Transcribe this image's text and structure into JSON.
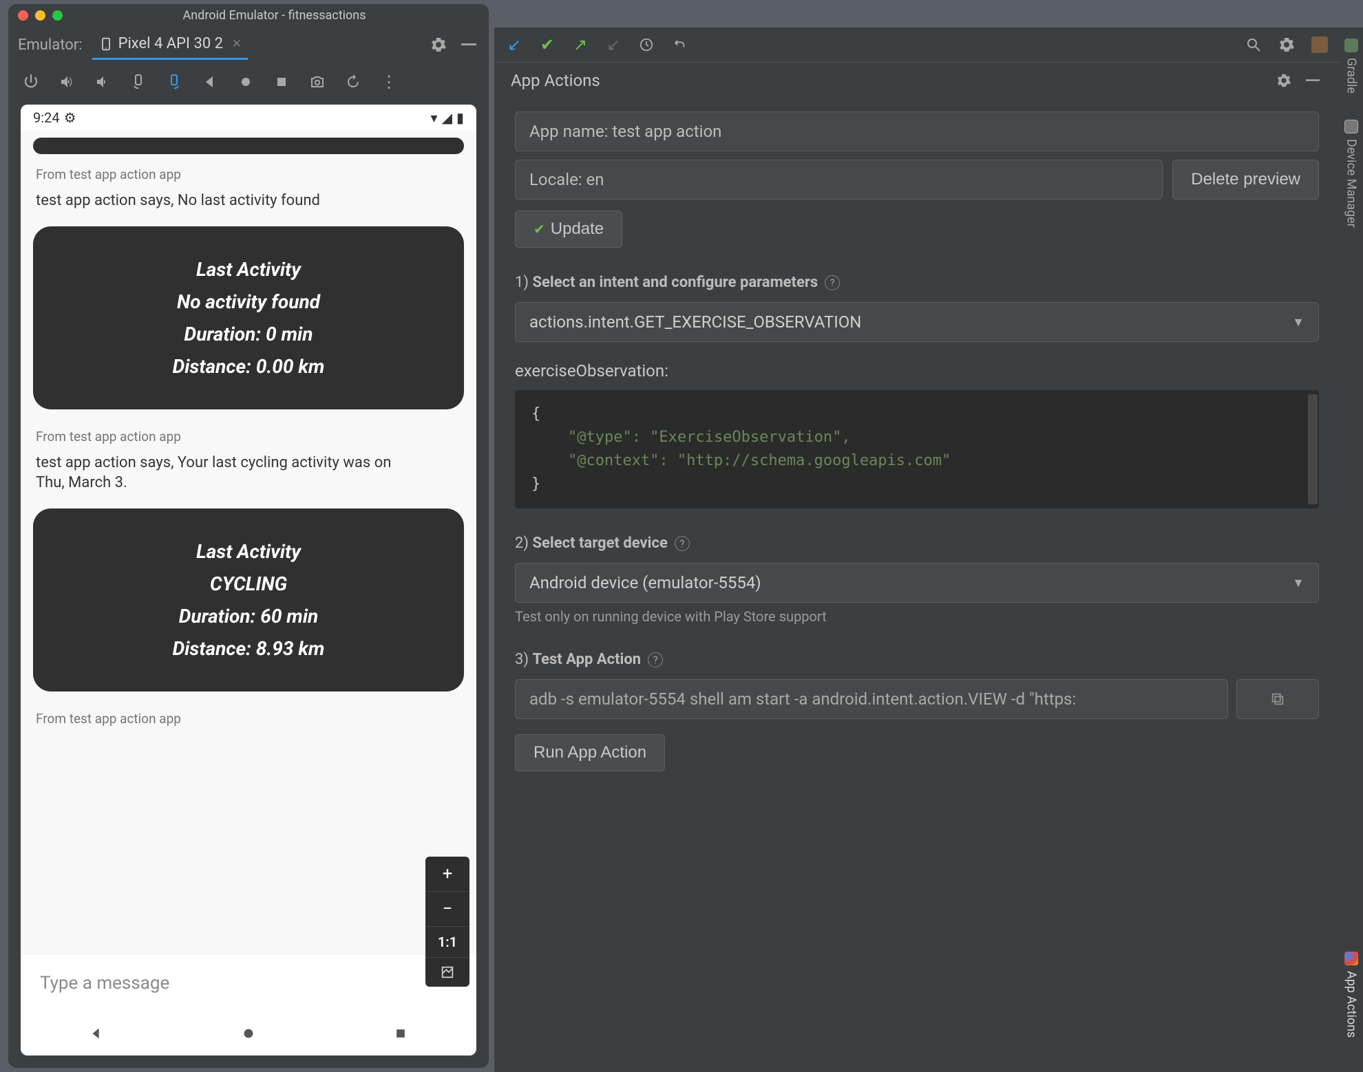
{
  "window": {
    "title": "Android Emulator - fitnessactions"
  },
  "emulator": {
    "label": "Emulator:",
    "tab": "Pixel 4 API 30 2"
  },
  "phone": {
    "status_time": "9:24",
    "from_label": "From test app action app",
    "speak1": "test app action says, No last activity found",
    "card1": {
      "l1": "Last Activity",
      "l2": "No activity found",
      "l3": "Duration: 0 min",
      "l4": "Distance: 0.00 km"
    },
    "speak2": "test app action says, Your last cycling activity was on Thu, March 3.",
    "card2": {
      "l1": "Last Activity",
      "l2": "CYCLING",
      "l3": "Duration: 60 min",
      "l4": "Distance: 8.93 km"
    },
    "input_placeholder": "Type a message",
    "zoom_1to1": "1:1"
  },
  "side_tabs": {
    "gradle": "Gradle",
    "device_mgr": "Device Manager",
    "app_actions": "App Actions"
  },
  "app_actions": {
    "panel_title": "App Actions",
    "app_name_field": "App name: test app action",
    "locale_field": "Locale: en",
    "delete_preview": "Delete preview",
    "update": "Update",
    "step1": "Select an intent and configure parameters",
    "intent_select": "actions.intent.GET_EXERCISE_OBSERVATION",
    "param_label": "exerciseObservation:",
    "code_l1": "{",
    "code_l2": "    \"@type\": \"ExerciseObservation\",",
    "code_l3": "    \"@context\": \"http://schema.googleapis.com\"",
    "code_l4": "}",
    "step2": "Select target device",
    "device_select": "Android device (emulator-5554)",
    "device_hint": "Test only on running device with Play Store support",
    "step3": "Test App Action",
    "adb_cmd": "adb -s emulator-5554 shell am start -a android.intent.action.VIEW -d \"https:",
    "run": "Run App Action"
  }
}
